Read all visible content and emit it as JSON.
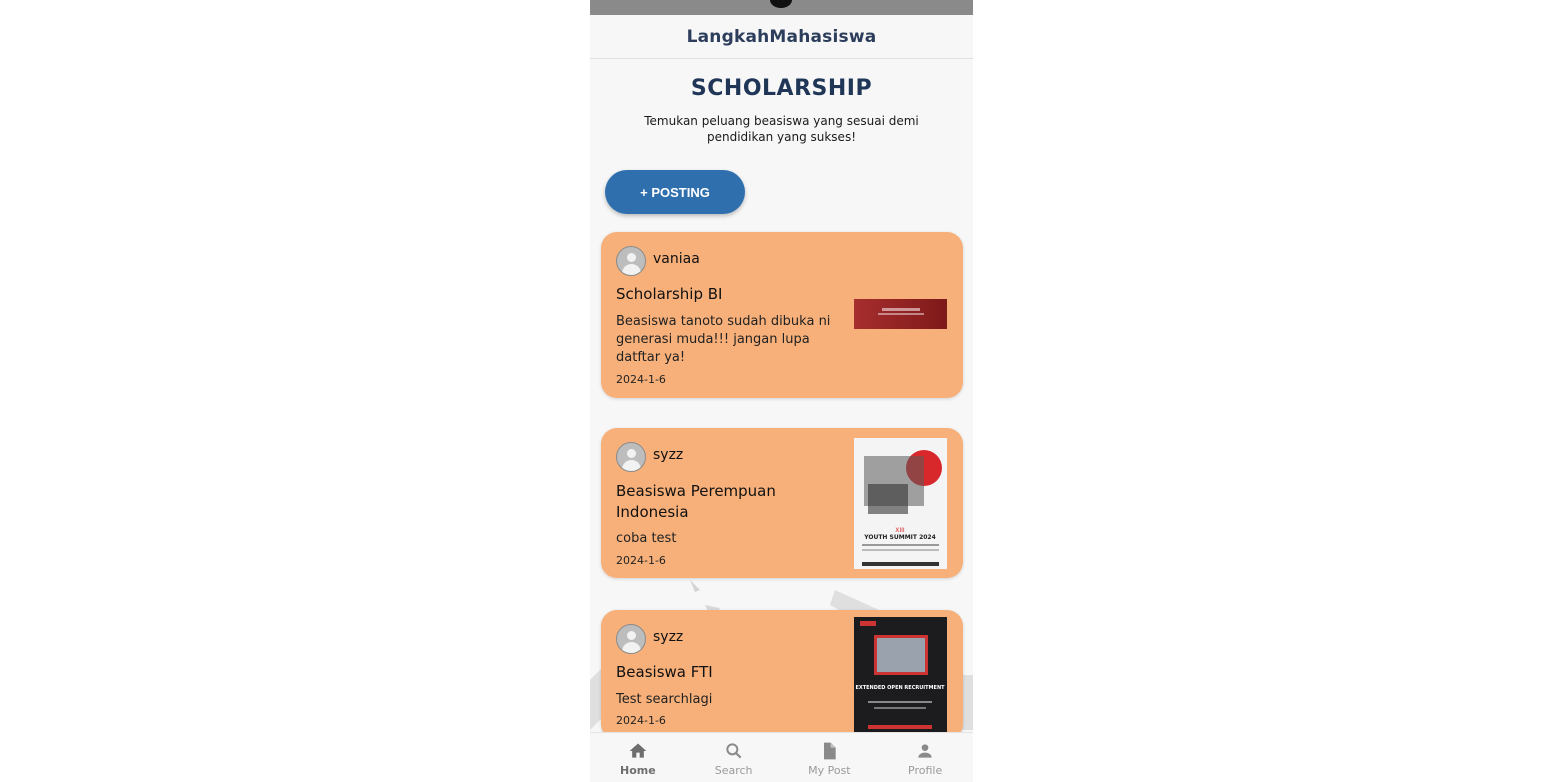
{
  "app": {
    "title": "LangkahMahasiswa"
  },
  "page": {
    "heading": "SCHOLARSHIP",
    "subtitle": "Temukan peluang beasiswa yang sesuai demi pendidikan yang sukses!",
    "post_button": "+ POSTING"
  },
  "posts": [
    {
      "username": "vaniaa",
      "title": "Scholarship BI",
      "description": "Beasiswa tanoto sudah dibuka ni generasi muda!!! jangan lupa datftar ya!",
      "date": "2024-1-6"
    },
    {
      "username": "syzz",
      "title": "Beasiswa Perempuan Indonesia",
      "description": "coba test",
      "date": "2024-1-6",
      "poster_text": "YOUTH SUMMIT 2024"
    },
    {
      "username": "syzz",
      "title": "Beasiswa FTI",
      "description": "Test searchlagi",
      "date": "2024-1-6",
      "poster_text": "EXTENDED OPEN RECRUITMENT"
    }
  ],
  "nav": {
    "items": [
      {
        "label": "Home",
        "icon": "home-icon",
        "active": true
      },
      {
        "label": "Search",
        "icon": "search-icon",
        "active": false
      },
      {
        "label": "My Post",
        "icon": "document-icon",
        "active": false
      },
      {
        "label": "Profile",
        "icon": "person-icon",
        "active": false
      }
    ]
  },
  "colors": {
    "card": "#f7b07a",
    "primary_button": "#2f6fad",
    "heading": "#1f3657"
  }
}
